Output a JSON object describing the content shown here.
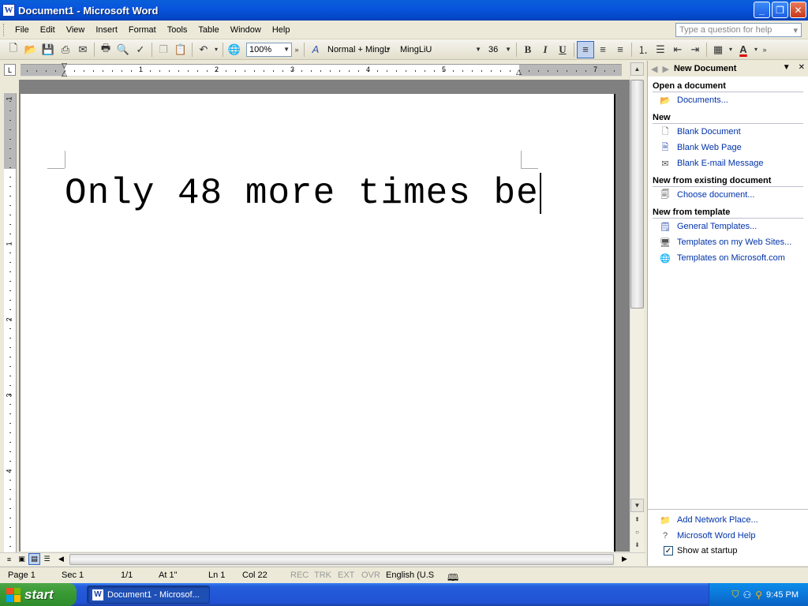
{
  "window": {
    "title": "Document1 - Microsoft Word",
    "app_icon": "W",
    "controls": {
      "minimize": "_",
      "maximize": "❐",
      "close": "✕"
    }
  },
  "menu": {
    "items": [
      {
        "label": "File"
      },
      {
        "label": "Edit"
      },
      {
        "label": "View"
      },
      {
        "label": "Insert"
      },
      {
        "label": "Format"
      },
      {
        "label": "Tools"
      },
      {
        "label": "Table"
      },
      {
        "label": "Window"
      },
      {
        "label": "Help"
      }
    ],
    "help_placeholder": "Type a question for help"
  },
  "toolbar": {
    "zoom": "100%",
    "style": "Normal + MingL",
    "font": "MingLiU",
    "size": "36",
    "bold": "B",
    "italic": "I",
    "underline": "U",
    "font_color_label": "A",
    "accent_font_color": "#E00000"
  },
  "ruler": {
    "h_numbers": [
      "1",
      "2",
      "3",
      "4",
      "5",
      "7"
    ],
    "v_numbers": [
      "1",
      "1",
      "2",
      "3",
      "4"
    ]
  },
  "document": {
    "text": "Only 48 more times be"
  },
  "taskpane": {
    "title": "New Document",
    "sections": [
      {
        "heading": "Open a document",
        "links": [
          {
            "label": "Documents...",
            "icon": "folder-icon"
          }
        ]
      },
      {
        "heading": "New",
        "links": [
          {
            "label": "Blank Document",
            "icon": "blank-document-icon"
          },
          {
            "label": "Blank Web Page",
            "icon": "web-page-icon"
          },
          {
            "label": "Blank E-mail Message",
            "icon": "email-icon"
          }
        ]
      },
      {
        "heading": "New from existing document",
        "links": [
          {
            "label": "Choose document...",
            "icon": "document-icon"
          }
        ]
      },
      {
        "heading": "New from template",
        "links": [
          {
            "label": "General Templates...",
            "icon": "template-icon"
          },
          {
            "label": "Templates on my Web Sites...",
            "icon": "web-template-icon"
          },
          {
            "label": "Templates on Microsoft.com",
            "icon": "globe-icon"
          }
        ]
      }
    ],
    "bottom_links": [
      {
        "label": "Add Network Place...",
        "icon": "network-folder-icon"
      },
      {
        "label": "Microsoft Word Help",
        "icon": "help-icon"
      }
    ],
    "show_at_startup": "Show at startup"
  },
  "statusbar": {
    "page": "Page 1",
    "sec": "Sec 1",
    "pages": "1/1",
    "at": "At 1\"",
    "ln": "Ln 1",
    "col": "Col 22",
    "rec": "REC",
    "trk": "TRK",
    "ext": "EXT",
    "ovr": "OVR",
    "language": "English (U.S"
  },
  "taskbar": {
    "start": "start",
    "task_button": "Document1 - Microsof...",
    "clock": "9:45 PM"
  }
}
